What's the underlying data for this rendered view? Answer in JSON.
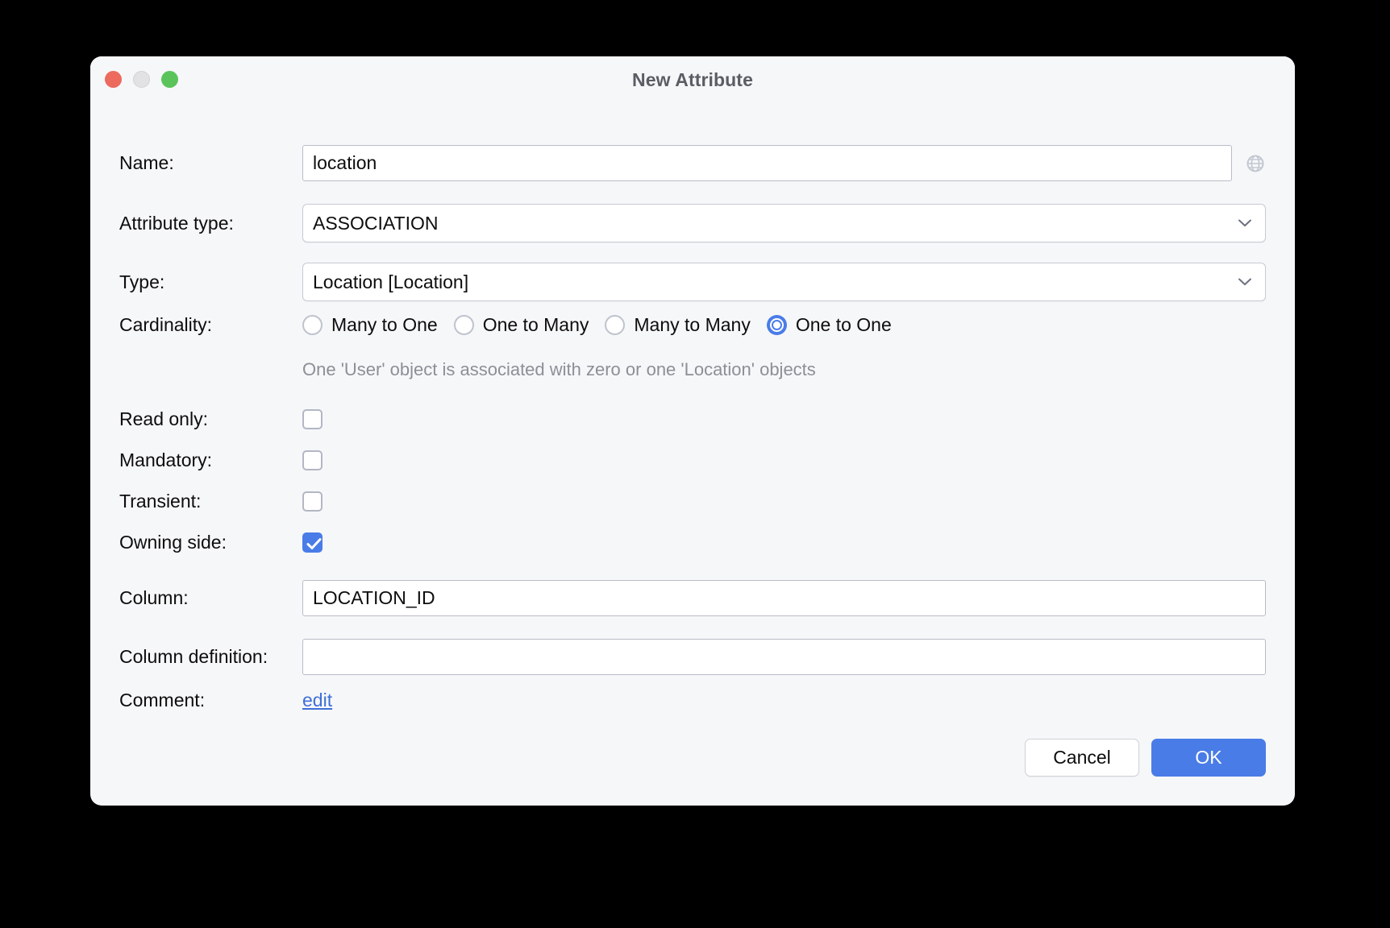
{
  "window": {
    "title": "New Attribute",
    "traffic_lights": [
      "close-red",
      "minimize-gray",
      "zoom-green"
    ]
  },
  "form": {
    "name": {
      "label": "Name:",
      "value": "location",
      "placeholder": "",
      "icon": "globe-icon"
    },
    "attribute_type": {
      "label": "Attribute type:",
      "value": "ASSOCIATION"
    },
    "type": {
      "label": "Type:",
      "value": "Location [Location]"
    },
    "cardinality": {
      "label": "Cardinality:",
      "options": [
        {
          "label": "Many to One",
          "selected": false
        },
        {
          "label": "One to Many",
          "selected": false
        },
        {
          "label": "Many to Many",
          "selected": false
        },
        {
          "label": "One to One",
          "selected": true
        }
      ],
      "hint": "One 'User' object is associated with zero or one 'Location' objects"
    },
    "read_only": {
      "label": "Read only:",
      "checked": false
    },
    "mandatory": {
      "label": "Mandatory:",
      "checked": false
    },
    "transient": {
      "label": "Transient:",
      "checked": false
    },
    "owning_side": {
      "label": "Owning side:",
      "checked": true
    },
    "column": {
      "label": "Column:",
      "value": "LOCATION_ID",
      "placeholder": ""
    },
    "column_definition": {
      "label": "Column definition:",
      "value": "",
      "placeholder": ""
    },
    "comment": {
      "label": "Comment:",
      "link_label": "edit"
    }
  },
  "footer": {
    "cancel_label": "Cancel",
    "ok_label": "OK"
  },
  "colors": {
    "accent": "#4a7ce8",
    "link": "#3f6fd8",
    "hint_text": "#8c8f96",
    "window_bg": "#f6f7f9",
    "title_text": "#5a5d64",
    "traffic_red": "#ec6a5e",
    "traffic_gray": "#e2e2e4",
    "traffic_green": "#5ac45a"
  }
}
